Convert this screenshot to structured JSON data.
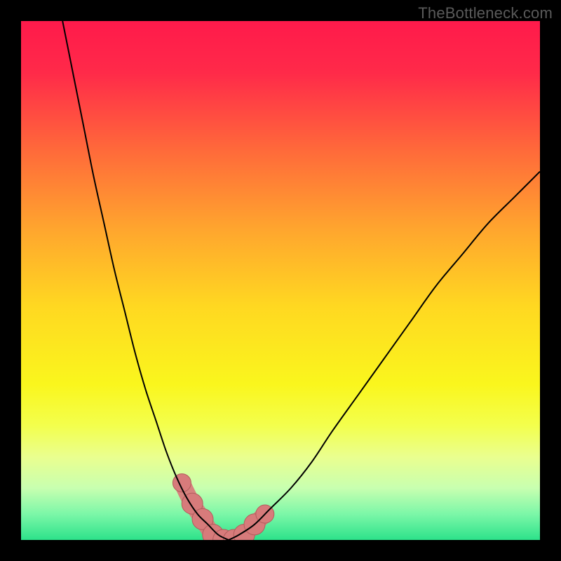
{
  "watermark": "TheBottleneck.com",
  "colors": {
    "frame": "#000000",
    "gradient_stops": [
      {
        "offset": 0.0,
        "color": "#ff1a4b"
      },
      {
        "offset": 0.1,
        "color": "#ff2a49"
      },
      {
        "offset": 0.25,
        "color": "#ff6a3a"
      },
      {
        "offset": 0.4,
        "color": "#ffa52e"
      },
      {
        "offset": 0.55,
        "color": "#ffd821"
      },
      {
        "offset": 0.7,
        "color": "#faf61d"
      },
      {
        "offset": 0.78,
        "color": "#f3ff4d"
      },
      {
        "offset": 0.84,
        "color": "#eaff8f"
      },
      {
        "offset": 0.9,
        "color": "#c8ffb0"
      },
      {
        "offset": 0.95,
        "color": "#7cf7a8"
      },
      {
        "offset": 1.0,
        "color": "#2de28a"
      }
    ],
    "curve_stroke": "#000000",
    "marker_fill": "#d77b7b",
    "marker_stroke": "#b25c5c"
  },
  "chart_data": {
    "type": "line",
    "title": "",
    "xlabel": "",
    "ylabel": "",
    "xlim": [
      0,
      100
    ],
    "ylim": [
      0,
      100
    ],
    "series": [
      {
        "name": "left-branch",
        "x": [
          8,
          10,
          12,
          14,
          16,
          18,
          20,
          22,
          24,
          26,
          28,
          30,
          32,
          34,
          36,
          38,
          40
        ],
        "y": [
          100,
          90,
          80,
          70,
          61,
          52,
          44,
          36,
          29,
          23,
          17,
          12,
          8,
          5,
          3,
          1,
          0
        ]
      },
      {
        "name": "right-branch",
        "x": [
          40,
          42,
          45,
          48,
          52,
          56,
          60,
          65,
          70,
          75,
          80,
          85,
          90,
          95,
          100
        ],
        "y": [
          0,
          1,
          3,
          6,
          10,
          15,
          21,
          28,
          35,
          42,
          49,
          55,
          61,
          66,
          71
        ]
      }
    ],
    "markers": {
      "name": "highlight-points",
      "x": [
        31,
        33,
        35,
        37,
        39,
        41,
        43,
        45,
        47
      ],
      "y": [
        11,
        7,
        4,
        1,
        0,
        0,
        1,
        3,
        5
      ]
    },
    "notes": "Axes are unlabeled in the source image; values are estimated on a 0–100 normalized scale from pixel geometry. The curve is a V-shaped bottleneck plot with its minimum near x≈40 and a thick salmon marker band around the trough."
  }
}
